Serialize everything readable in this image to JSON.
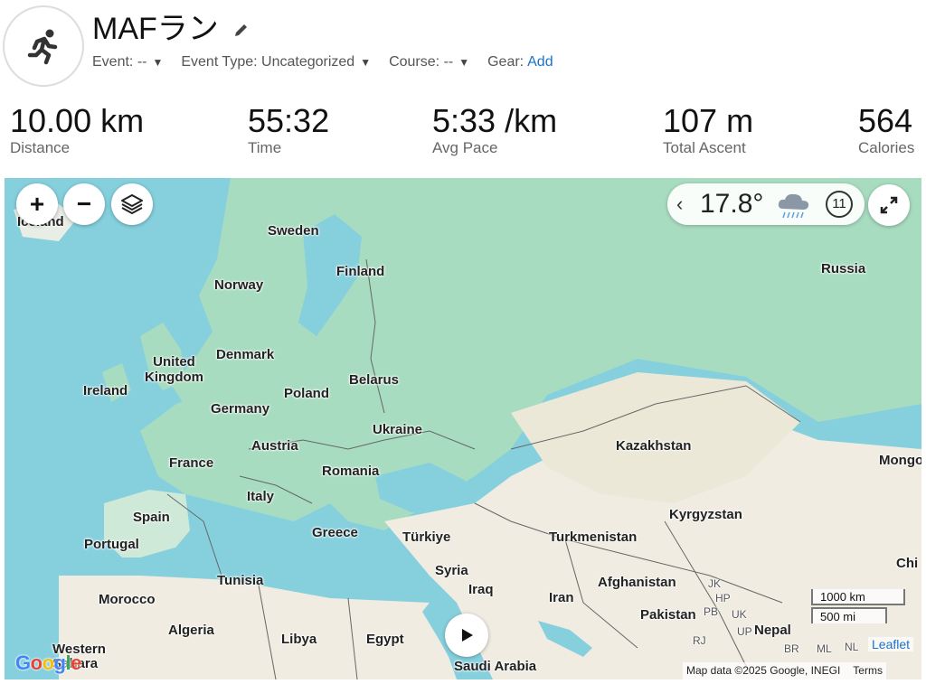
{
  "activity": {
    "title": "MAFラン",
    "icon": "runner-icon",
    "edit_icon": "pencil-icon"
  },
  "meta": {
    "event_label": "Event:",
    "event_value": "--",
    "event_type_label": "Event Type:",
    "event_type_value": "Uncategorized",
    "course_label": "Course:",
    "course_value": "--",
    "gear_label": "Gear:",
    "gear_add": "Add"
  },
  "stats": [
    {
      "value": "10.00 km",
      "label": "Distance"
    },
    {
      "value": "55:32",
      "label": "Time"
    },
    {
      "value": "5:33 /km",
      "label": "Avg Pace"
    },
    {
      "value": "107 m",
      "label": "Total Ascent"
    },
    {
      "value": "564",
      "label": "Calories"
    }
  ],
  "map": {
    "zoom_in": "+",
    "zoom_out": "−",
    "weather": {
      "temperature": "17.8°",
      "wind": "11",
      "condition_icon": "rain-cloud-icon"
    },
    "labels": {
      "iceland": "Iceland",
      "sweden": "Sweden",
      "finland": "Finland",
      "norway": "Norway",
      "russia": "Russia",
      "uk": "United\nKingdom",
      "denmark": "Denmark",
      "ireland": "Ireland",
      "poland": "Poland",
      "belarus": "Belarus",
      "germany": "Germany",
      "ukraine": "Ukraine",
      "austria": "Austria",
      "france": "France",
      "romania": "Romania",
      "kazakhstan": "Kazakhstan",
      "mongolia": "Mongo",
      "italy": "Italy",
      "spain": "Spain",
      "kyrgyzstan": "Kyrgyzstan",
      "greece": "Greece",
      "turkiye": "Türkiye",
      "turkmenistan": "Turkmenistan",
      "portugal": "Portugal",
      "syria": "Syria",
      "china": "Chi",
      "tunisia": "Tunisia",
      "afghanistan": "Afghanistan",
      "iraq": "Iraq",
      "iran": "Iran",
      "morocco": "Morocco",
      "algeria": "Algeria",
      "pakistan": "Pakistan",
      "libya": "Libya",
      "egypt": "Egypt",
      "nepal": "Nepal",
      "western_sahara": "Western\nSahara",
      "saudi": "Saudi Arabia",
      "jk": "JK",
      "hp": "HP",
      "pb": "PB",
      "uk_in": "UK",
      "rj": "RJ",
      "up": "UP",
      "br": "BR",
      "ml": "ML",
      "nl": "NL"
    },
    "scale_km": "1000 km",
    "scale_mi": "500 mi",
    "leaflet": "Leaflet",
    "attribution": "Map data ©2025 Google, INEGI",
    "terms": "Terms",
    "google": "Google"
  },
  "colors": {
    "water": "#86d0de",
    "land_green": "#a8dcc0",
    "land_desert": "#f0ece2",
    "link": "#1a73c9"
  }
}
